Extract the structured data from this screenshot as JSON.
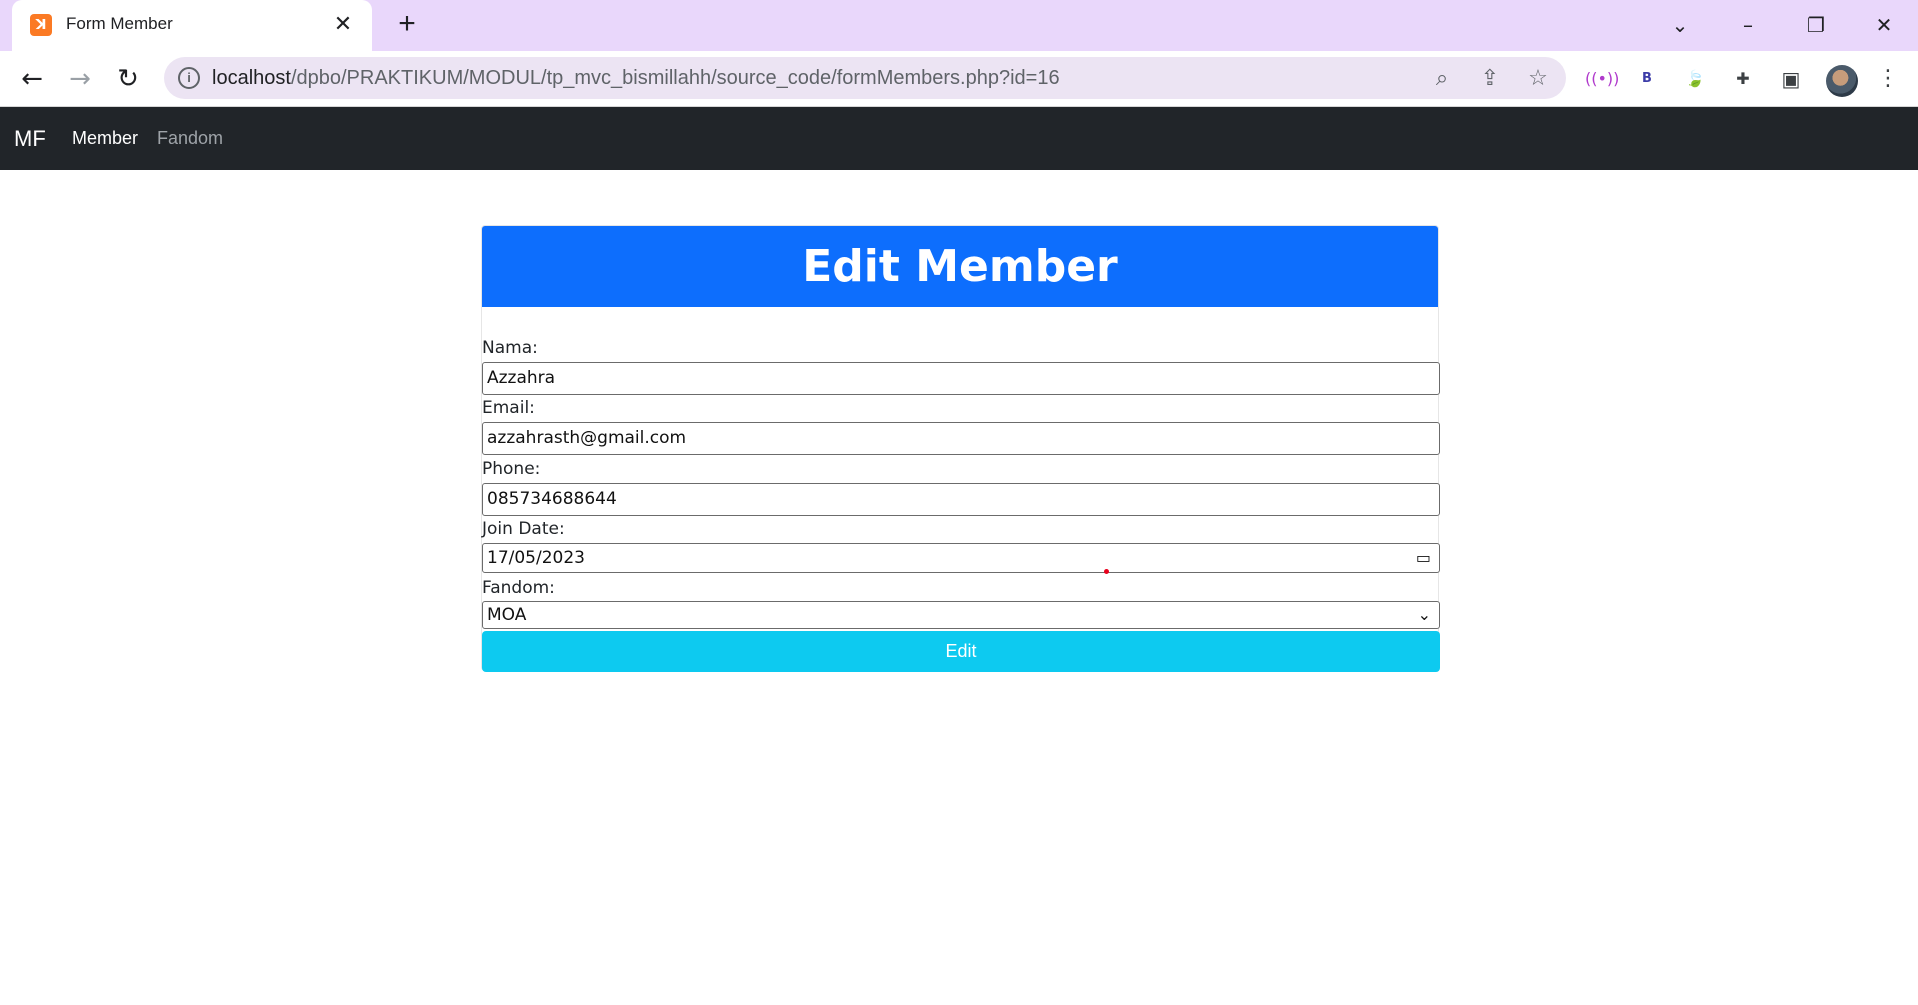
{
  "browser": {
    "tab_title": "Form Member",
    "tab_close": "✕",
    "new_tab": "+",
    "url_host": "localhost",
    "url_path": "/dpbo/PRAKTIKUM/MODUL/tp_mvc_bismillahh/source_code/formMembers.php?id=16",
    "extensions": [
      "broadcast-icon",
      "b-extension-icon",
      "leaf-extension-icon",
      "puzzle-icon",
      "sidepanel-icon"
    ],
    "ext_b_label": "B"
  },
  "navbar": {
    "brand": "MF",
    "links": [
      "Member",
      "Fandom"
    ],
    "bg_color": "#212529"
  },
  "form": {
    "header": "Edit Member",
    "header_color": "#0d6efd",
    "fields": {
      "nama_label": "Nama:",
      "nama_value": "Azzahra",
      "email_label": "Email:",
      "email_value": "azzahrasth@gmail.com",
      "phone_label": "Phone:",
      "phone_value": "085734688644",
      "join_label": "Join Date:",
      "join_value": "17/05/2023",
      "fandom_label": "Fandom:",
      "fandom_value": "MOA"
    },
    "submit": "Edit",
    "submit_color": "#0dcaf0"
  }
}
